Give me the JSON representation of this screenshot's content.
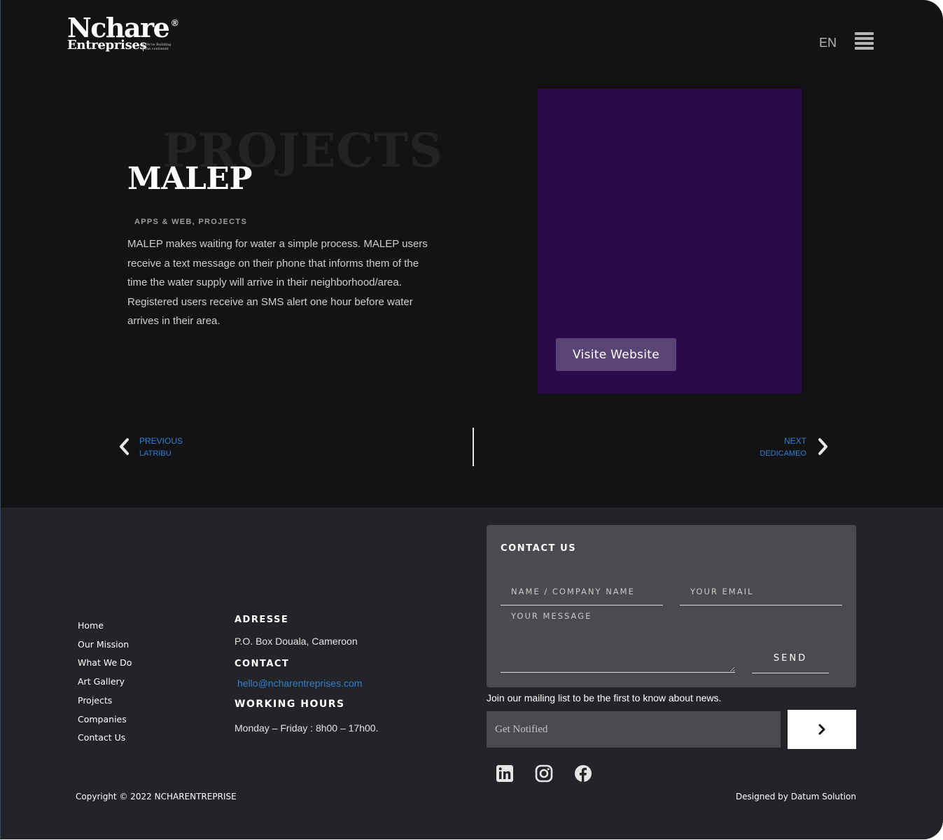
{
  "header": {
    "logo_main": "Nchare",
    "logo_registered": "®",
    "logo_sub": "Entreprises",
    "logo_tagline": "We're Building the continent",
    "language": "EN",
    "menu_icon": "hamburger-menu-icon"
  },
  "project": {
    "background_word": "PROJECTS",
    "title": "MALEP",
    "categories": "APPS & WEB, PROJECTS",
    "description": "MALEP makes waiting for water a simple process. MALEP users receive a text message on their phone that informs them of the time the water supply will arrive in their neighborhood/area. Registered users receive an SMS alert one hour before water arrives in their area.",
    "media_color": "#2b0a4b",
    "visit_button": "Visite Website"
  },
  "pager": {
    "prev_label": "PREVIOUS",
    "prev_title": "LATRIBU",
    "next_label": "NEXT",
    "next_title": "DEDICAMEO",
    "link_color": "#2f7fd1"
  },
  "footer": {
    "nav": [
      "Home",
      "Our Mission",
      "What We Do",
      "Art Gallery",
      "Projects",
      "Companies",
      "Contact Us"
    ],
    "address_heading": "ADRESSE",
    "address": "P.O. Box Douala, Cameroon",
    "contact_heading": "CONTACT",
    "email": "hello@ncharentreprises.com",
    "hours_heading": "WORKING HOURS",
    "hours": "Monday – Friday : 8h00 – 17h00.",
    "contact_form": {
      "title": "CONTACT US",
      "name_placeholder": "NAME / COMPANY NAME",
      "email_placeholder": "YOUR EMAIL",
      "message_placeholder": "YOUR MESSAGE",
      "send_label": "SEND"
    },
    "mailing_text": "Join our mailing list to be the first to know about news.",
    "notify_placeholder": "Get Notified",
    "social_icons": [
      "linkedin-icon",
      "instagram-icon",
      "facebook-icon"
    ],
    "copyright": "Copyright © 2022 NCHARENTREPRISE",
    "designed_by": "Designed by Datum Solution"
  }
}
